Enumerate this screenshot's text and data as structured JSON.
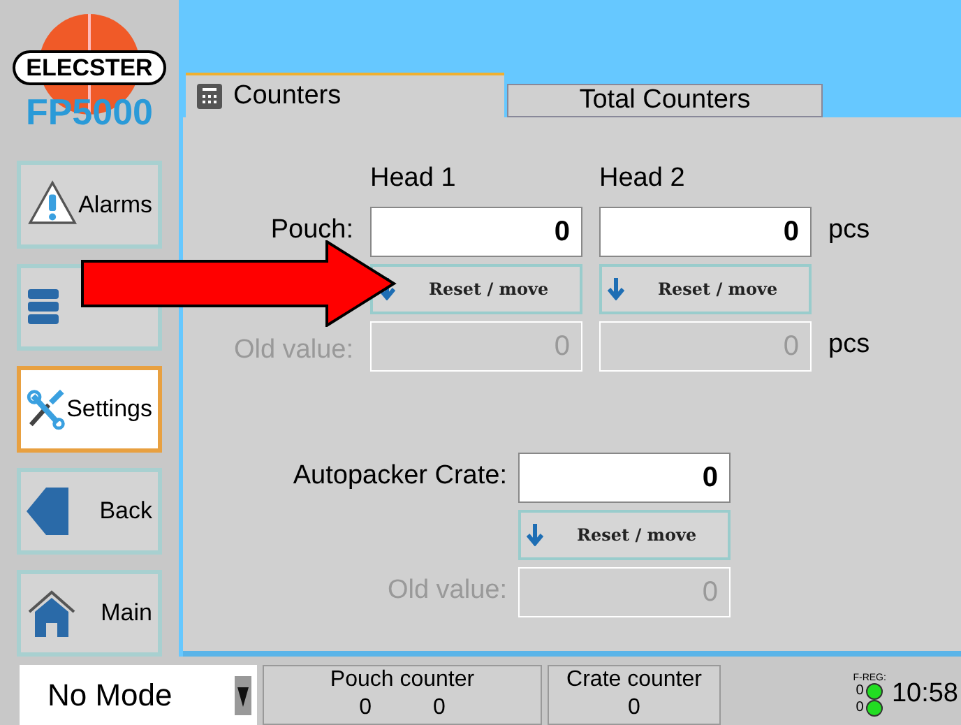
{
  "logo": {
    "brand": "ELECSTER",
    "model": "FP5000"
  },
  "sidebar": {
    "items": [
      {
        "kind": "alarm",
        "label": "Alarms",
        "selected": false
      },
      {
        "kind": "recipe",
        "selected": false
      },
      {
        "kind": "settings",
        "label": "Settings",
        "selected": true
      },
      {
        "kind": "back",
        "label": "Back",
        "selected": false
      },
      {
        "kind": "home",
        "label": "Main",
        "selected": false
      }
    ]
  },
  "tabs": [
    {
      "label": "Counters",
      "selected": true,
      "icon": true
    },
    {
      "label": "Total Counters",
      "selected": false,
      "icon": false
    }
  ],
  "pouch": {
    "columns": [
      "Head 1",
      "Head 2"
    ],
    "label": "Pouch:",
    "values": [
      "0",
      "0"
    ],
    "unit": "pcs",
    "reset_buttons": [
      "Reset / move",
      "Reset / move"
    ],
    "old_label": "Old value:",
    "old_values": [
      "0",
      "0"
    ],
    "old_unit": "pcs"
  },
  "crate": {
    "label": "Autopacker Crate:",
    "value": "0",
    "reset_button": "Reset / move",
    "old_label": "Old value:",
    "old_value": "0"
  },
  "status_bar": {
    "mode": "No Mode",
    "pouch_counter": {
      "title": "Pouch counter",
      "values": [
        "0",
        "0"
      ]
    },
    "crate_counter": {
      "title": "Crate counter",
      "value": "0"
    },
    "freg": {
      "label": "F-REG:",
      "values": [
        "0",
        "0"
      ],
      "color": "#22dd22"
    },
    "time": "10:58"
  },
  "annotation_arrow": true
}
